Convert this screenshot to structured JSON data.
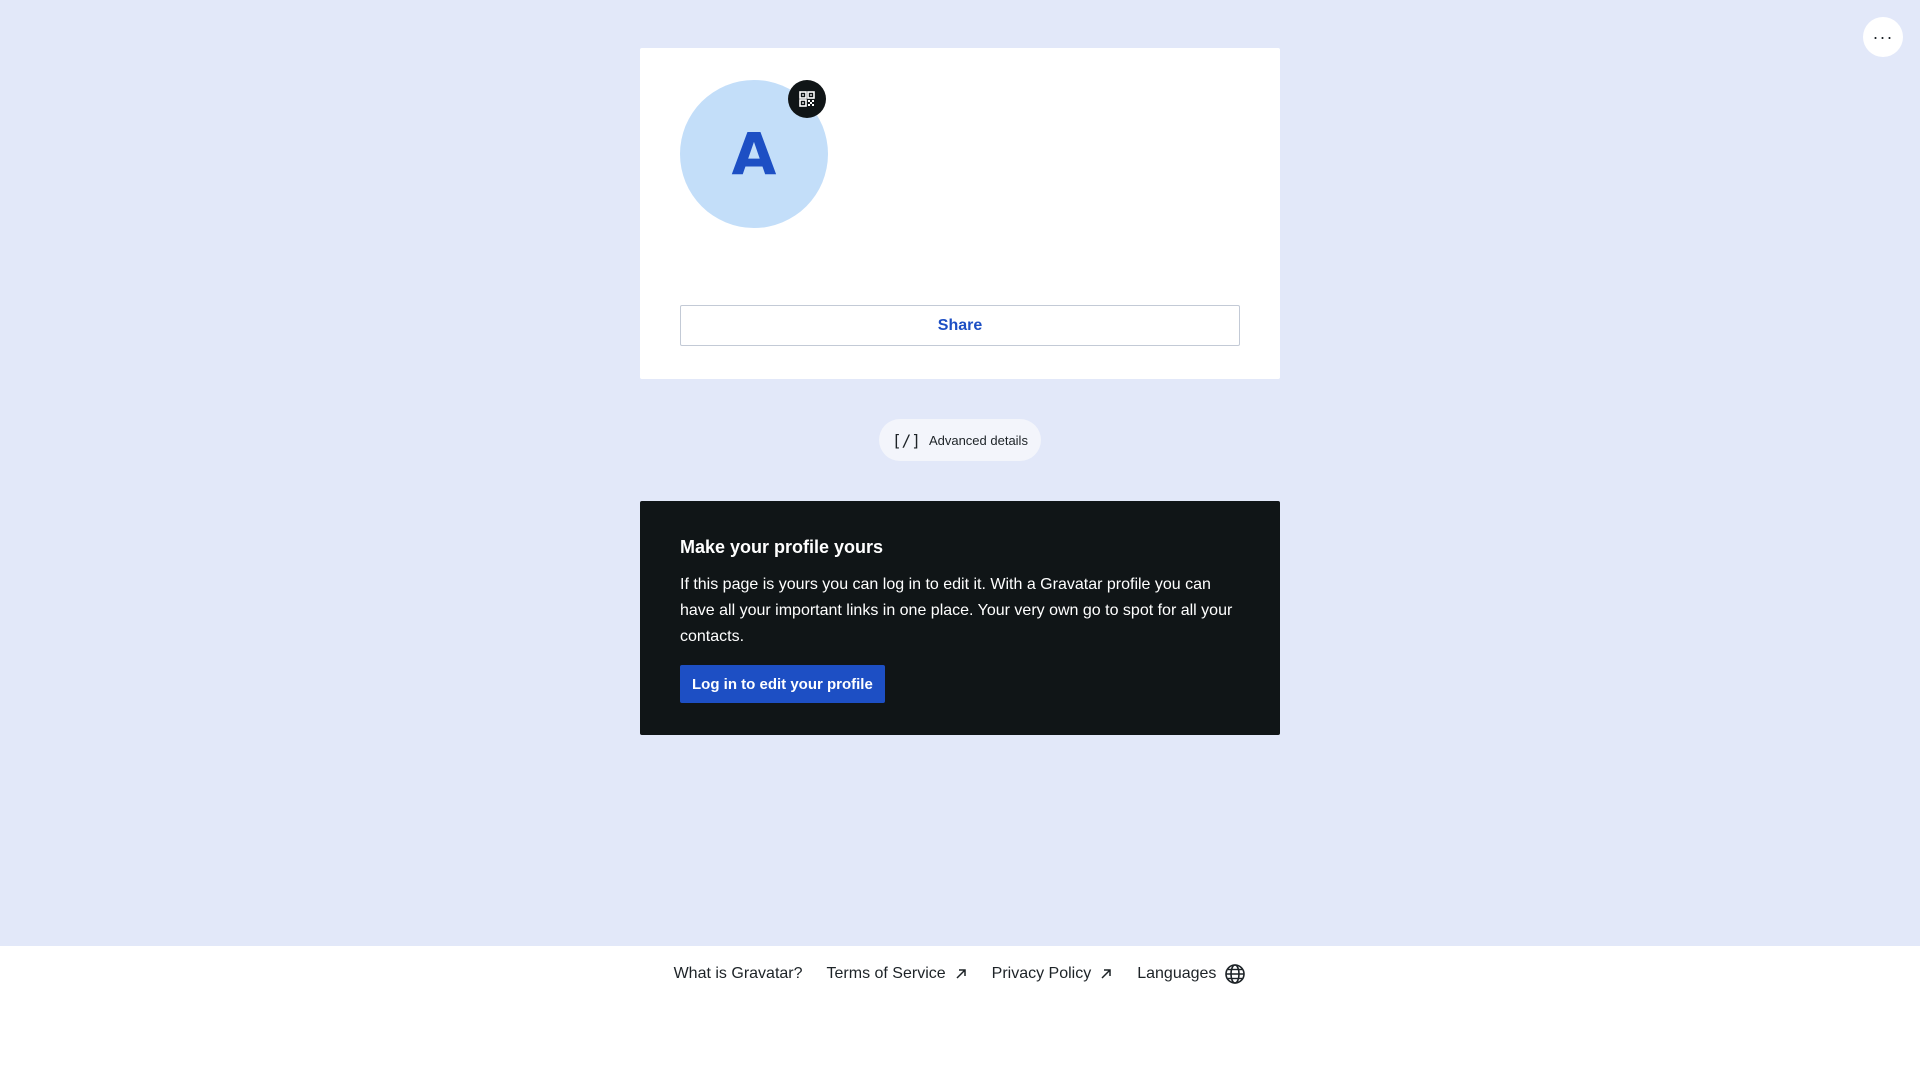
{
  "header": {
    "more_label": "···"
  },
  "profile_card": {
    "avatar_initial": "A",
    "share_label": "Share"
  },
  "advanced": {
    "icon_text": "[/]",
    "label": "Advanced details"
  },
  "promo": {
    "title": "Make your profile yours",
    "text": "If this page is yours you can log in to edit it. With a Gravatar profile you can have all your important links in one place. Your very own go to spot for all your contacts.",
    "button_label": "Log in to edit your profile"
  },
  "footer": {
    "links": [
      {
        "label": "What is Gravatar?",
        "icon": null
      },
      {
        "label": "Terms of Service",
        "icon": "external-arrow-icon"
      },
      {
        "label": "Privacy Policy",
        "icon": "external-arrow-icon"
      },
      {
        "label": "Languages",
        "icon": "globe-icon"
      }
    ]
  },
  "colors": {
    "page_bg": "#e2e8f9",
    "accent": "#1d4fc4",
    "avatar_bg": "#c3def9",
    "dark_card": "#101517"
  }
}
